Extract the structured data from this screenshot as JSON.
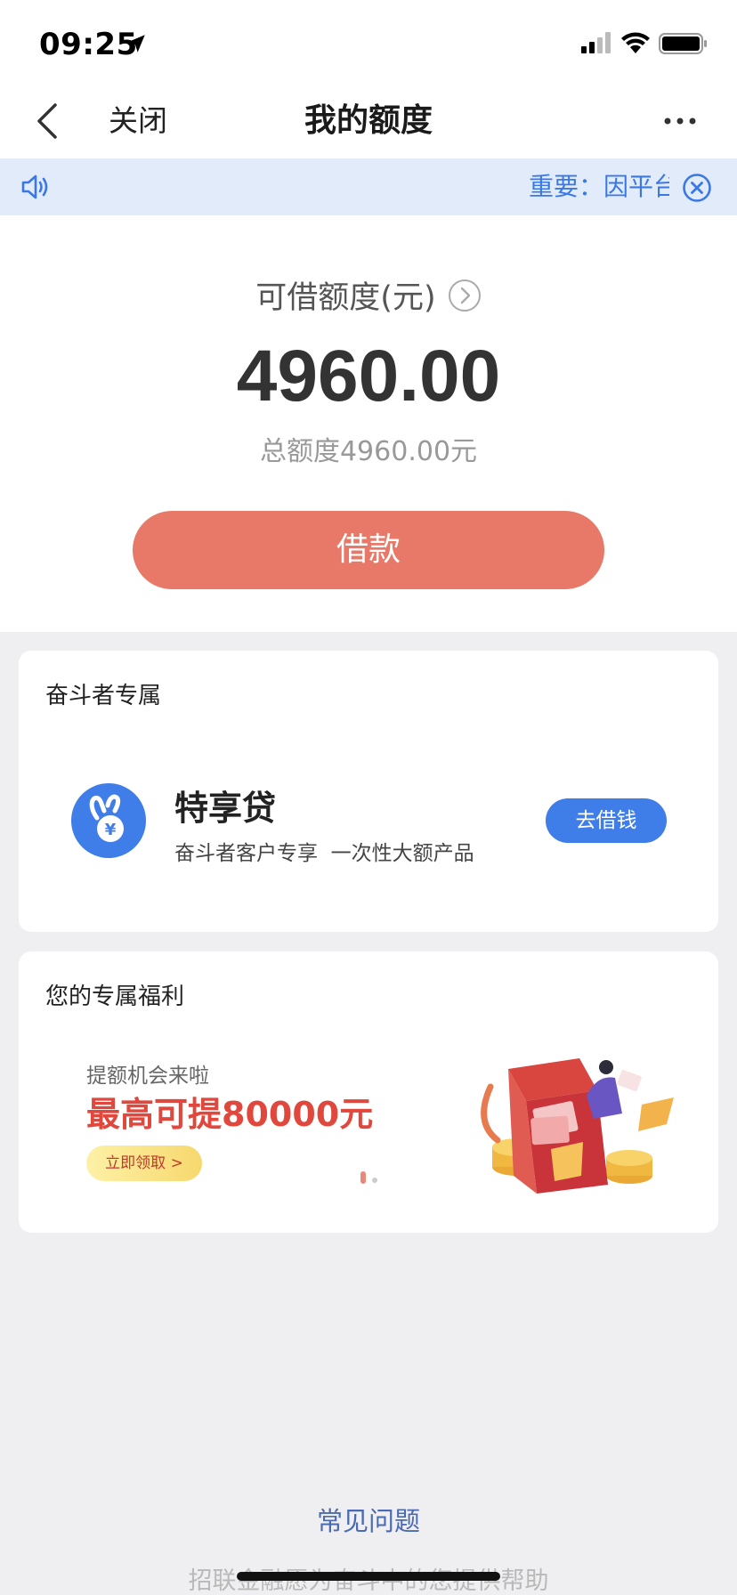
{
  "status_bar": {
    "time": "09:25"
  },
  "nav": {
    "close_label": "关闭",
    "title": "我的额度"
  },
  "notice": {
    "text": "重要：因平台"
  },
  "quota": {
    "label": "可借额度(元)",
    "amount": "4960.00",
    "total": "总额度4960.00元",
    "borrow_button": "借款"
  },
  "striver_card": {
    "title": "奋斗者专属",
    "product_name": "特享贷",
    "product_desc": "奋斗者客户专享  一次性大额产品",
    "action_button": "去借钱"
  },
  "benefit_card": {
    "title": "您的专属福利",
    "banner_sub": "提额机会来啦",
    "banner_main": "最高可提80000元",
    "banner_claim": "立即领取 >"
  },
  "footer": {
    "faq": "常见问题",
    "text": "招联金融愿为奋斗中的您提供帮助"
  },
  "colors": {
    "accent_blue": "#3f7de8",
    "borrow_red": "#e87868",
    "notice_bg": "#e2ebfa"
  }
}
